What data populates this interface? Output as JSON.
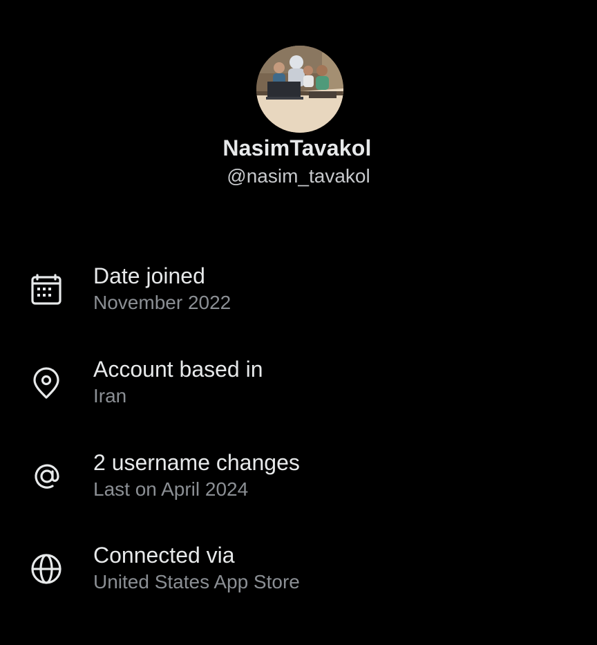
{
  "profile": {
    "display_name": "NasimTavakol",
    "handle": "@nasim_tavakol",
    "avatar_description": "avatar"
  },
  "info": [
    {
      "icon": "calendar-icon",
      "title": "Date joined",
      "subtitle": "November 2022"
    },
    {
      "icon": "location-pin-icon",
      "title": "Account based in",
      "subtitle": "Iran"
    },
    {
      "icon": "at-sign-icon",
      "title": "2 username changes",
      "subtitle": "Last on April 2024"
    },
    {
      "icon": "globe-icon",
      "title": "Connected via",
      "subtitle": "United States App Store"
    }
  ],
  "colors": {
    "background": "#000000",
    "primary_text": "#e7e9ea",
    "secondary_text": "#8b8f94"
  }
}
